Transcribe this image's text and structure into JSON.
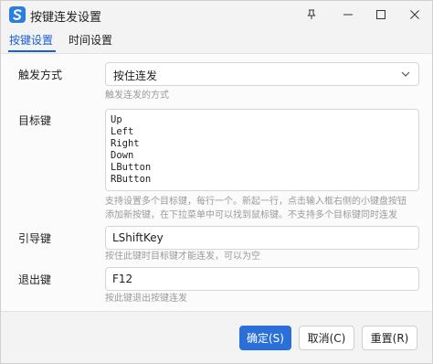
{
  "window": {
    "title": "按键连发设置",
    "app_icon": "s-logo-icon",
    "controls": [
      "pin-icon",
      "minimize-icon",
      "maximize-icon",
      "close-icon"
    ]
  },
  "tabs": [
    {
      "label": "按键设置",
      "active": true
    },
    {
      "label": "时间设置",
      "active": false
    }
  ],
  "form": {
    "trigger_mode": {
      "label": "触发方式",
      "value": "按住连发",
      "help": "触发连发的方式"
    },
    "target_keys": {
      "label": "目标键",
      "lines": [
        "Up",
        "Left",
        "Right",
        "Down",
        "LButton",
        "RButton"
      ],
      "help_line1": "支持设置多个目标键，每行一个。新起一行，点击输入框右侧的小键盘按钮",
      "help_line2": "添加新按键，在下拉菜单中可以找到鼠标键。不支持多个目标键同时连发"
    },
    "guide_key": {
      "label": "引导键",
      "value": "LShiftKey",
      "help": "按住此键时目标键才能连发，可以为空"
    },
    "exit_key": {
      "label": "退出键",
      "value": "F12",
      "help": "按此键退出按键连发"
    }
  },
  "footer": {
    "ok_label": "确定(S)",
    "cancel_label": "取消(C)",
    "reset_label": "重置(R)"
  },
  "colors": {
    "accent": "#2b6fd8",
    "tab_active": "#1a5fd0",
    "help_text": "#9a9a9a"
  }
}
